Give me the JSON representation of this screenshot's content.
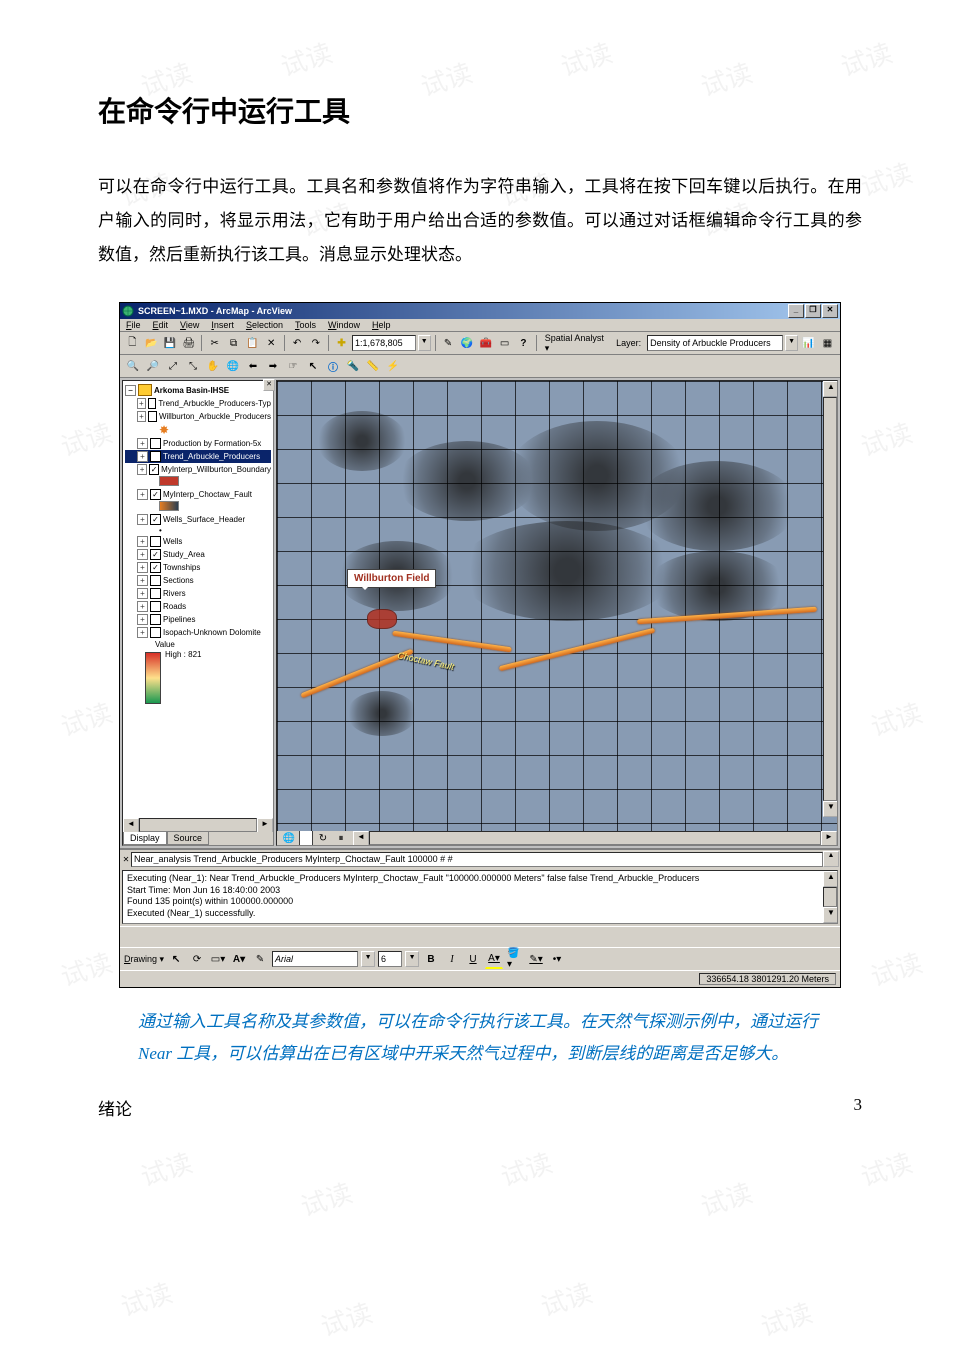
{
  "doc": {
    "heading": "在命令行中运行工具",
    "body": "可以在命令行中运行工具。工具名和参数值将作为字符串输入，工具将在按下回车键以后执行。在用户输入的同时，将显示用法，它有助于用户给出合适的参数值。可以通过对话框编辑命令行工具的参数值，然后重新执行该工具。消息显示处理状态。",
    "caption": "通过输入工具名称及其参数值，可以在命令行执行该工具。在天然气探测示例中，通过运行 Near 工具，可以估算出在已有区域中开采天然气过程中，到断层线的距离是否足够大。",
    "footer_left": "绪论",
    "footer_right": "3",
    "watermark": "试读"
  },
  "app": {
    "title": "SCREEN~1.MXD - ArcMap - ArcView",
    "menus": {
      "file": "File",
      "edit": "Edit",
      "view": "View",
      "insert": "Insert",
      "selection": "Selection",
      "tools": "Tools",
      "window": "Window",
      "help": "Help"
    },
    "toolbar1": {
      "scale": "1:1,678,805",
      "extension_label": "Spatial Analyst ▾",
      "layer_label": "Layer:",
      "layer_value": "Density of Arbuckle Producers"
    },
    "toc": {
      "root": "Arkoma Basin-IHSE",
      "items": [
        {
          "check": false,
          "label": "Trend_Arbuckle_Producers-Typ"
        },
        {
          "check": false,
          "label": "Willburton_Arbuckle_Producers"
        },
        {
          "check": false,
          "label": "Production by Formation-5x"
        },
        {
          "check": false,
          "label": "Trend_Arbuckle_Producers",
          "selected": true
        },
        {
          "check": true,
          "label": "MyInterp_Willburton_Boundary"
        },
        {
          "check": true,
          "label": "MyInterp_Choctaw_Fault"
        },
        {
          "check": true,
          "label": "Wells_Surface_Header"
        },
        {
          "check": false,
          "label": "Wells"
        },
        {
          "check": true,
          "label": "Study_Area"
        },
        {
          "check": true,
          "label": "Townships"
        },
        {
          "check": false,
          "label": "Sections"
        },
        {
          "check": false,
          "label": "Rivers"
        },
        {
          "check": false,
          "label": "Roads"
        },
        {
          "check": false,
          "label": "Pipelines"
        },
        {
          "check": false,
          "label": "Isopach-Unknown Dolomite"
        }
      ],
      "value_label": "Value",
      "high_label": "High : 821",
      "tab_display": "Display",
      "tab_source": "Source"
    },
    "map": {
      "callout": "Willburton Field",
      "fault_label": "Choctaw Fault"
    },
    "command": {
      "input_value": "Near_analysis Trend_Arbuckle_Producers MyInterp_Choctaw_Fault 100000 # #",
      "log_lines": [
        "Executing (Near_1): Near Trend_Arbuckle_Producers MyInterp_Choctaw_Fault \"100000.000000 Meters\" false false Trend_Arbuckle_Producers",
        "Start Time: Mon Jun 16 18:40:00 2003",
        "Found 135 point(s) within 100000.000000",
        "Executed (Near_1) successfully."
      ]
    },
    "drawing": {
      "label": "Drawing ▾",
      "font_name": "Arial",
      "font_size": "6"
    },
    "status": "336654.18 3801291.20 Meters"
  }
}
